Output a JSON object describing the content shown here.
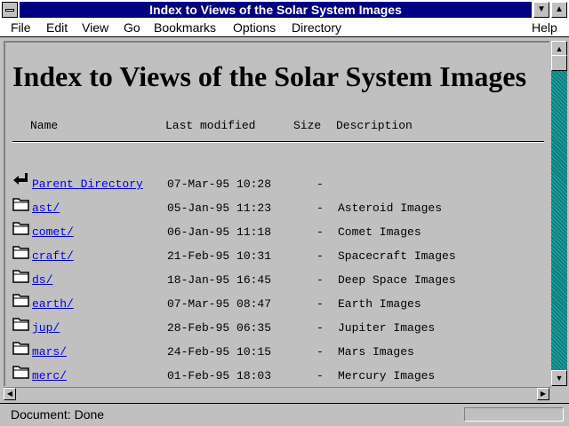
{
  "window": {
    "title": "Index to Views of the Solar System Images"
  },
  "menu": [
    "File",
    "Edit",
    "View",
    "Go",
    "Bookmarks",
    "Options",
    "Directory",
    "Help"
  ],
  "page": {
    "title": "Index to Views of the Solar System Images",
    "columns": {
      "name": "Name",
      "modified": "Last modified",
      "size": "Size",
      "description": "Description"
    },
    "rows": [
      {
        "name": "Parent Directory",
        "modified": "07-Mar-95 10:28",
        "size": "-",
        "description": "",
        "icon": "parent-directory-icon"
      },
      {
        "name": "ast/",
        "modified": "05-Jan-95 11:23",
        "size": "-",
        "description": "Asteroid Images",
        "icon": "folder-icon"
      },
      {
        "name": "comet/",
        "modified": "06-Jan-95 11:18",
        "size": "-",
        "description": "Comet Images",
        "icon": "folder-icon"
      },
      {
        "name": "craft/",
        "modified": "21-Feb-95 10:31",
        "size": "-",
        "description": "Spacecraft Images",
        "icon": "folder-icon"
      },
      {
        "name": "ds/",
        "modified": "18-Jan-95 16:45",
        "size": "-",
        "description": "Deep Space Images",
        "icon": "folder-icon"
      },
      {
        "name": "earth/",
        "modified": "07-Mar-95 08:47",
        "size": "-",
        "description": "Earth Images",
        "icon": "folder-icon"
      },
      {
        "name": "jup/",
        "modified": "28-Feb-95 06:35",
        "size": "-",
        "description": "Jupiter Images",
        "icon": "folder-icon"
      },
      {
        "name": "mars/",
        "modified": "24-Feb-95 10:15",
        "size": "-",
        "description": "Mars Images",
        "icon": "folder-icon"
      },
      {
        "name": "merc/",
        "modified": "01-Feb-95 18:03",
        "size": "-",
        "description": "Mercury Images",
        "icon": "folder-icon"
      }
    ]
  },
  "status": {
    "text": "Document: Done"
  },
  "colors": {
    "link": "#0000ee",
    "titlebar": "#000080",
    "scroll_track": "#008080",
    "background": "#c0c0c0"
  }
}
